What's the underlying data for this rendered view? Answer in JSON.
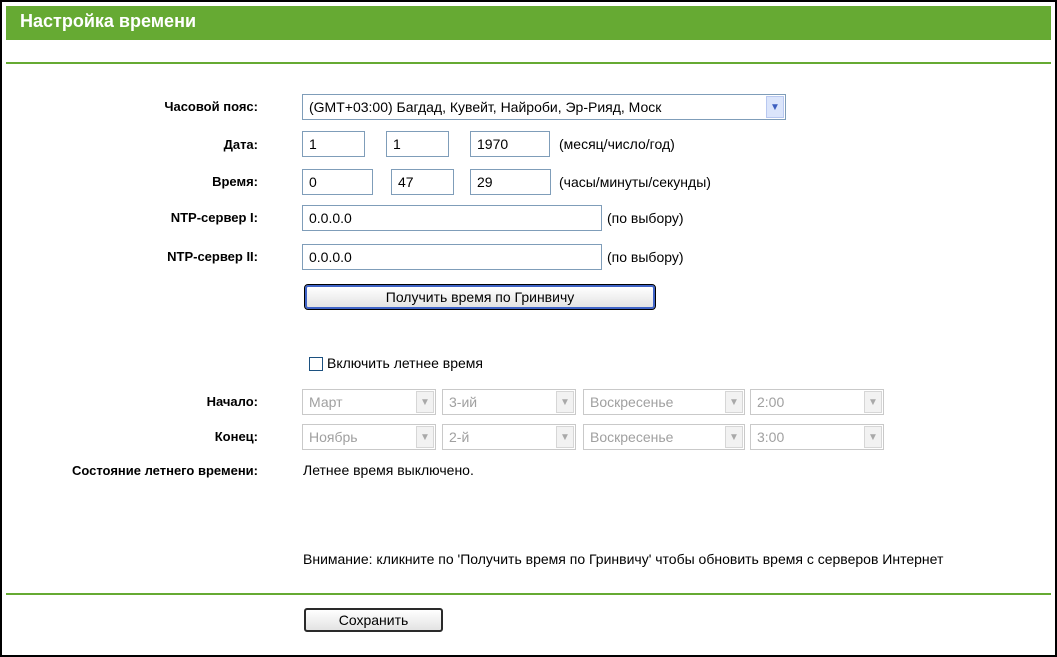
{
  "header": {
    "title": "Настройка времени"
  },
  "form": {
    "timezone": {
      "label": "Часовой пояс:",
      "value": "(GMT+03:00) Багдад, Кувейт, Найроби, Эр-Рияд, Моск"
    },
    "date": {
      "label": "Дата:",
      "month": "1",
      "day": "1",
      "year": "1970",
      "hint": "(месяц/число/год)"
    },
    "time": {
      "label": "Время:",
      "hours": "0",
      "minutes": "47",
      "seconds": "29",
      "hint": "(часы/минуты/секунды)"
    },
    "ntp1": {
      "label": "NTP-сервер I:",
      "value": "0.0.0.0",
      "hint": "(по выбору)"
    },
    "ntp2": {
      "label": "NTP-сервер II:",
      "value": "0.0.0.0",
      "hint": "(по выбору)"
    },
    "get_gmt_button": "Получить время по Гринвичу",
    "dst_checkbox": {
      "label": "Включить летнее время",
      "checked": false
    },
    "start": {
      "label": "Начало:",
      "month": "Март",
      "week": "3-ий",
      "weekday": "Воскресенье",
      "time": "2:00"
    },
    "end": {
      "label": "Конец:",
      "month": "Ноябрь",
      "week": "2-й",
      "weekday": "Воскресенье",
      "time": "3:00"
    },
    "dst_status": {
      "label": "Состояние летнего времени:",
      "value": "Летнее время выключено."
    },
    "note": "Внимание: кликните по 'Получить время по Гринвичу' чтобы обновить время с серверов Интернет",
    "save_button": "Сохранить"
  },
  "colors": {
    "accent": "#66aa33",
    "title_text": "#ffffff",
    "disabled_text": "#a0a0a0"
  },
  "icons": {
    "dropdown": "chevron-down-icon"
  }
}
